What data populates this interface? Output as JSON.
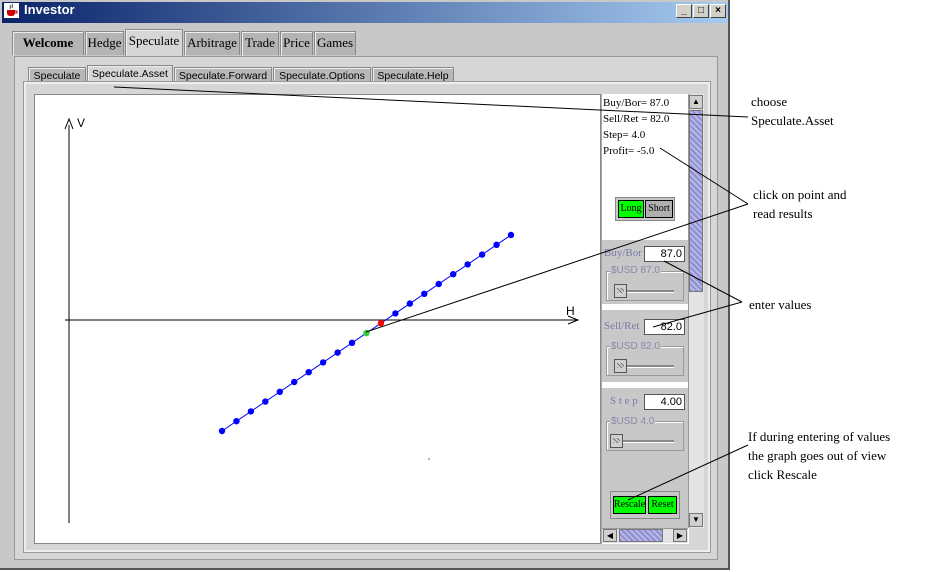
{
  "window": {
    "title": "Investor"
  },
  "main_tabs": [
    {
      "label": "Welcome",
      "selected": false
    },
    {
      "label": "Hedge",
      "selected": false
    },
    {
      "label": "Speculate",
      "selected": true
    },
    {
      "label": "Arbitrage",
      "selected": false
    },
    {
      "label": "Trade",
      "selected": false
    },
    {
      "label": "Price",
      "selected": false
    },
    {
      "label": "Games",
      "selected": false
    }
  ],
  "sub_tabs": [
    {
      "label": "Speculate",
      "selected": false
    },
    {
      "label": "Speculate.Asset",
      "selected": true
    },
    {
      "label": "Speculate.Forward",
      "selected": false
    },
    {
      "label": "Speculate.Options",
      "selected": false
    },
    {
      "label": "Speculate.Help",
      "selected": false
    }
  ],
  "graph": {
    "y_axis_label": "V",
    "x_axis_label": "H",
    "points_color": "#0000ff",
    "selected_point_color": "#ff0000",
    "breakeven_point_color": "#33cc33"
  },
  "results": {
    "buy_bor": "Buy/Bor= 87.0",
    "sell_ret": "Sell/Ret = 82.0",
    "step": "Step= 4.0",
    "profit": "Profit= -5.0"
  },
  "position_buttons": {
    "long": "Long",
    "short": "Short"
  },
  "controls": {
    "buy_bor": {
      "label": "Buy/Bor",
      "value": "87.0",
      "slider_label": "$USD 87.0"
    },
    "sell_ret": {
      "label": "Sell/Ret",
      "value": "82.0",
      "slider_label": "$USD 82.0"
    },
    "step": {
      "label": "S t e p",
      "value": "4.00",
      "slider_label": "$USD 4.0"
    }
  },
  "action_buttons": {
    "rescale": "Rescale",
    "reset": "Reset"
  },
  "annotations": {
    "choose_1": "choose",
    "choose_2": "Speculate.Asset",
    "click_1": "click on point and",
    "click_2": "read results",
    "enter": "enter values",
    "rescale_1": "If during entering of values",
    "rescale_2": "the graph goes out of view",
    "rescale_3": "click Rescale"
  },
  "colors": {
    "title_start": "#0a246a",
    "title_end": "#a6caf0",
    "button_green": "#00ff00"
  }
}
